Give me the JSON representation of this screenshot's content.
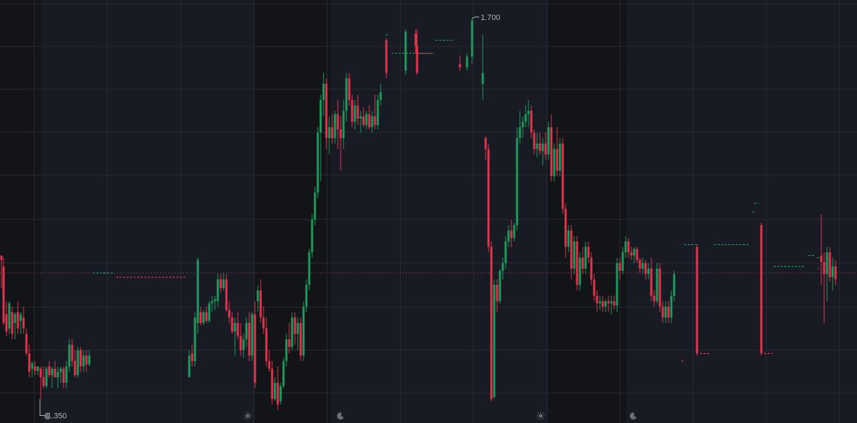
{
  "colors": {
    "background": "#181b23",
    "session_band": "#121418",
    "grid": "#262a33",
    "up": "#1f9a5c",
    "down": "#e0354c",
    "current_price_line": "#b54a55",
    "label_text": "#b2b5be",
    "icon": "#6a6f7a"
  },
  "chart_data": {
    "type": "candlestick",
    "ylim": [
      1.328,
      1.717
    ],
    "grid": true,
    "current_price": 1.466,
    "annotations": {
      "high": {
        "label": "1.700",
        "value": 1.7,
        "x": 661
      },
      "low": {
        "label": "1.350",
        "value": 1.35,
        "x": 56
      }
    },
    "session_markers": [
      {
        "x": 67,
        "icon": "moon-icon"
      },
      {
        "x": 347,
        "icon": "sun-icon"
      },
      {
        "x": 477,
        "icon": "moon-icon"
      },
      {
        "x": 757,
        "icon": "sun-icon"
      },
      {
        "x": 887,
        "icon": "moon-icon"
      }
    ],
    "candles": [
      [
        2,
        1.482,
        1.48,
        1.452,
        1.478
      ],
      [
        5,
        1.472,
        1.48,
        1.418,
        1.42
      ],
      [
        9,
        1.428,
        1.44,
        1.408,
        1.412
      ],
      [
        13,
        1.415,
        1.44,
        1.41,
        1.438
      ],
      [
        17,
        1.43,
        1.435,
        1.405,
        1.41
      ],
      [
        21,
        1.42,
        1.43,
        1.405,
        1.428
      ],
      [
        25,
        1.43,
        1.44,
        1.41,
        1.415
      ],
      [
        29,
        1.422,
        1.43,
        1.41,
        1.428
      ],
      [
        33,
        1.425,
        1.435,
        1.41,
        1.415
      ],
      [
        37,
        1.41,
        1.415,
        1.39,
        1.392
      ],
      [
        41,
        1.392,
        1.4,
        1.37,
        1.375
      ],
      [
        45,
        1.378,
        1.385,
        1.37,
        1.383
      ],
      [
        49,
        1.38,
        1.385,
        1.372,
        1.376
      ],
      [
        53,
        1.376,
        1.38,
        1.372,
        1.38
      ],
      [
        57,
        1.378,
        1.38,
        1.35,
        1.37
      ],
      [
        61,
        1.37,
        1.38,
        1.36,
        1.362
      ],
      [
        65,
        1.362,
        1.38,
        1.36,
        1.378
      ],
      [
        69,
        1.38,
        1.385,
        1.37,
        1.372
      ],
      [
        73,
        1.372,
        1.38,
        1.36,
        1.378
      ],
      [
        77,
        1.378,
        1.385,
        1.37,
        1.37
      ],
      [
        81,
        1.37,
        1.38,
        1.36,
        1.375
      ],
      [
        85,
        1.375,
        1.38,
        1.365,
        1.378
      ],
      [
        89,
        1.378,
        1.38,
        1.36,
        1.365
      ],
      [
        93,
        1.365,
        1.385,
        1.36,
        1.38
      ],
      [
        97,
        1.38,
        1.405,
        1.375,
        1.4
      ],
      [
        101,
        1.4,
        1.405,
        1.38,
        1.385
      ],
      [
        105,
        1.385,
        1.395,
        1.37,
        1.372
      ],
      [
        109,
        1.372,
        1.398,
        1.37,
        1.395
      ],
      [
        113,
        1.395,
        1.398,
        1.375,
        1.38
      ],
      [
        117,
        1.38,
        1.395,
        1.375,
        1.39
      ],
      [
        121,
        1.39,
        1.395,
        1.375,
        1.382
      ],
      [
        125,
        1.382,
        1.395,
        1.38,
        1.39
      ],
      [
        265,
        1.37,
        1.395,
        1.37,
        1.39
      ],
      [
        269,
        1.392,
        1.4,
        1.38,
        1.385
      ],
      [
        273,
        1.385,
        1.43,
        1.38,
        1.425
      ],
      [
        277,
        1.42,
        1.48,
        1.41,
        1.478
      ],
      [
        281,
        1.43,
        1.435,
        1.418,
        1.42
      ],
      [
        285,
        1.42,
        1.432,
        1.418,
        1.43
      ],
      [
        289,
        1.43,
        1.435,
        1.42,
        1.422
      ],
      [
        293,
        1.422,
        1.44,
        1.42,
        1.438
      ],
      [
        297,
        1.438,
        1.445,
        1.43,
        1.44
      ],
      [
        301,
        1.44,
        1.445,
        1.432,
        1.442
      ],
      [
        305,
        1.44,
        1.465,
        1.435,
        1.46
      ],
      [
        309,
        1.46,
        1.465,
        1.448,
        1.452
      ],
      [
        313,
        1.452,
        1.466,
        1.45,
        1.46
      ],
      [
        317,
        1.46,
        1.465,
        1.43,
        1.432
      ],
      [
        321,
        1.432,
        1.44,
        1.42,
        1.425
      ],
      [
        325,
        1.425,
        1.43,
        1.41,
        1.412
      ],
      [
        329,
        1.412,
        1.425,
        1.39,
        1.42
      ],
      [
        333,
        1.42,
        1.43,
        1.405,
        1.408
      ],
      [
        337,
        1.408,
        1.42,
        1.39,
        1.395
      ],
      [
        341,
        1.395,
        1.41,
        1.388,
        1.405
      ],
      [
        345,
        1.405,
        1.425,
        1.398,
        1.42
      ],
      [
        349,
        1.42,
        1.43,
        1.385,
        1.39
      ],
      [
        353,
        1.39,
        1.43,
        1.385,
        1.428
      ],
      [
        357,
        1.428,
        1.44,
        1.36,
        1.365
      ],
      [
        361,
        1.44,
        1.455,
        1.43,
        1.45
      ],
      [
        365,
        1.45,
        1.46,
        1.42,
        1.425
      ],
      [
        369,
        1.425,
        1.435,
        1.41,
        1.415
      ],
      [
        373,
        1.415,
        1.425,
        1.38,
        1.385
      ],
      [
        377,
        1.385,
        1.395,
        1.375,
        1.378
      ],
      [
        381,
        1.378,
        1.385,
        1.345,
        1.35
      ],
      [
        385,
        1.35,
        1.37,
        1.348,
        1.365
      ],
      [
        389,
        1.365,
        1.38,
        1.34,
        1.345
      ],
      [
        393,
        1.348,
        1.365,
        1.345,
        1.362
      ],
      [
        397,
        1.362,
        1.388,
        1.36,
        1.385
      ],
      [
        401,
        1.385,
        1.41,
        1.38,
        1.405
      ],
      [
        405,
        1.405,
        1.42,
        1.392,
        1.398
      ],
      [
        409,
        1.398,
        1.43,
        1.395,
        1.425
      ],
      [
        413,
        1.425,
        1.43,
        1.4,
        1.41
      ],
      [
        417,
        1.41,
        1.425,
        1.395,
        1.42
      ],
      [
        421,
        1.42,
        1.425,
        1.385,
        1.39
      ],
      [
        425,
        1.39,
        1.44,
        1.385,
        1.435
      ],
      [
        429,
        1.435,
        1.46,
        1.43,
        1.455
      ],
      [
        433,
        1.455,
        1.488,
        1.45,
        1.485
      ],
      [
        437,
        1.485,
        1.52,
        1.48,
        1.515
      ],
      [
        441,
        1.515,
        1.545,
        1.51,
        1.54
      ],
      [
        445,
        1.54,
        1.6,
        1.535,
        1.595
      ],
      [
        449,
        1.595,
        1.63,
        1.55,
        1.625
      ],
      [
        453,
        1.625,
        1.65,
        1.61,
        1.64
      ],
      [
        457,
        1.64,
        1.645,
        1.58,
        1.59
      ],
      [
        461,
        1.59,
        1.61,
        1.575,
        1.6
      ],
      [
        465,
        1.6,
        1.612,
        1.585,
        1.59
      ],
      [
        469,
        1.59,
        1.615,
        1.585,
        1.612
      ],
      [
        473,
        1.612,
        1.625,
        1.58,
        1.598
      ],
      [
        477,
        1.598,
        1.61,
        1.56,
        1.59
      ],
      [
        481,
        1.59,
        1.625,
        1.58,
        1.615
      ],
      [
        485,
        1.615,
        1.65,
        1.605,
        1.645
      ],
      [
        489,
        1.645,
        1.65,
        1.62,
        1.625
      ],
      [
        493,
        1.625,
        1.63,
        1.6,
        1.605
      ],
      [
        497,
        1.605,
        1.625,
        1.598,
        1.62
      ],
      [
        501,
        1.62,
        1.63,
        1.602,
        1.608
      ],
      [
        505,
        1.608,
        1.615,
        1.595,
        1.61
      ],
      [
        509,
        1.61,
        1.618,
        1.6,
        1.602
      ],
      [
        513,
        1.602,
        1.615,
        1.598,
        1.612
      ],
      [
        517,
        1.612,
        1.62,
        1.598,
        1.6
      ],
      [
        521,
        1.6,
        1.615,
        1.595,
        1.61
      ],
      [
        525,
        1.61,
        1.63,
        1.598,
        1.602
      ],
      [
        529,
        1.602,
        1.63,
        1.598,
        1.625
      ],
      [
        533,
        1.625,
        1.64,
        1.62,
        1.632
      ],
      [
        541,
        1.68,
        1.682,
        1.645,
        1.65
      ],
      [
        568,
        1.652,
        1.69,
        1.648,
        1.688
      ],
      [
        582,
        1.686,
        1.69,
        1.668,
        1.675
      ],
      [
        584,
        1.675,
        1.69,
        1.648,
        1.65
      ],
      [
        644,
        1.658,
        1.666,
        1.652,
        1.655
      ],
      [
        654,
        1.655,
        1.668,
        1.652,
        1.665
      ],
      [
        661,
        1.665,
        1.7,
        1.658,
        1.698
      ],
      [
        676,
        1.64,
        1.685,
        1.625,
        1.65
      ],
      [
        680,
        1.59,
        1.592,
        1.57,
        1.58
      ],
      [
        684,
        1.58,
        1.585,
        1.485,
        1.49
      ],
      [
        688,
        1.49,
        1.495,
        1.348,
        1.35
      ],
      [
        692,
        1.352,
        1.46,
        1.35,
        1.455
      ],
      [
        696,
        1.455,
        1.46,
        1.43,
        1.44
      ],
      [
        700,
        1.44,
        1.47,
        1.438,
        1.468
      ],
      [
        704,
        1.468,
        1.48,
        1.46,
        1.475
      ],
      [
        708,
        1.475,
        1.5,
        1.47,
        1.495
      ],
      [
        712,
        1.495,
        1.51,
        1.49,
        1.505
      ],
      [
        716,
        1.505,
        1.515,
        1.49,
        1.498
      ],
      [
        720,
        1.498,
        1.512,
        1.495,
        1.51
      ],
      [
        724,
        1.51,
        1.6,
        1.505,
        1.59
      ],
      [
        728,
        1.59,
        1.615,
        1.585,
        1.6
      ],
      [
        732,
        1.6,
        1.61,
        1.59,
        1.605
      ],
      [
        736,
        1.605,
        1.62,
        1.6,
        1.612
      ],
      [
        740,
        1.612,
        1.625,
        1.6,
        1.615
      ],
      [
        744,
        1.615,
        1.62,
        1.59,
        1.595
      ],
      [
        748,
        1.595,
        1.598,
        1.575,
        1.58
      ],
      [
        752,
        1.58,
        1.595,
        1.572,
        1.585
      ],
      [
        756,
        1.585,
        1.595,
        1.575,
        1.578
      ],
      [
        760,
        1.578,
        1.59,
        1.565,
        1.585
      ],
      [
        764,
        1.585,
        1.595,
        1.57,
        1.575
      ],
      [
        768,
        1.575,
        1.605,
        1.57,
        1.6
      ],
      [
        772,
        1.6,
        1.612,
        1.55,
        1.555
      ],
      [
        776,
        1.555,
        1.585,
        1.55,
        1.58
      ],
      [
        780,
        1.58,
        1.6,
        1.555,
        1.56
      ],
      [
        784,
        1.56,
        1.59,
        1.555,
        1.585
      ],
      [
        788,
        1.585,
        1.59,
        1.52,
        1.525
      ],
      [
        792,
        1.525,
        1.53,
        1.48,
        1.49
      ],
      [
        796,
        1.49,
        1.51,
        1.485,
        1.505
      ],
      [
        800,
        1.505,
        1.51,
        1.46,
        1.47
      ],
      [
        804,
        1.47,
        1.5,
        1.465,
        1.495
      ],
      [
        808,
        1.495,
        1.5,
        1.45,
        1.455
      ],
      [
        812,
        1.455,
        1.485,
        1.45,
        1.48
      ],
      [
        816,
        1.48,
        1.49,
        1.465,
        1.47
      ],
      [
        820,
        1.47,
        1.495,
        1.465,
        1.49
      ],
      [
        824,
        1.49,
        1.495,
        1.475,
        1.48
      ],
      [
        828,
        1.48,
        1.485,
        1.455,
        1.46
      ],
      [
        832,
        1.46,
        1.465,
        1.44,
        1.445
      ],
      [
        836,
        1.445,
        1.45,
        1.43,
        1.438
      ],
      [
        840,
        1.438,
        1.445,
        1.432,
        1.44
      ],
      [
        844,
        1.44,
        1.445,
        1.43,
        1.435
      ],
      [
        848,
        1.435,
        1.442,
        1.43,
        1.44
      ],
      [
        852,
        1.44,
        1.445,
        1.43,
        1.438
      ],
      [
        856,
        1.438,
        1.445,
        1.428,
        1.44
      ],
      [
        860,
        1.44,
        1.445,
        1.432,
        1.436
      ],
      [
        864,
        1.436,
        1.48,
        1.43,
        1.475
      ],
      [
        868,
        1.475,
        1.48,
        1.46,
        1.468
      ],
      [
        872,
        1.468,
        1.49,
        1.465,
        1.485
      ],
      [
        876,
        1.485,
        1.5,
        1.48,
        1.495
      ],
      [
        880,
        1.495,
        1.498,
        1.48,
        1.485
      ],
      [
        884,
        1.485,
        1.49,
        1.478,
        1.482
      ],
      [
        888,
        1.482,
        1.49,
        1.475,
        1.488
      ],
      [
        892,
        1.488,
        1.49,
        1.475,
        1.478
      ],
      [
        896,
        1.478,
        1.48,
        1.466,
        1.47
      ],
      [
        900,
        1.47,
        1.48,
        1.465,
        1.475
      ],
      [
        904,
        1.475,
        1.478,
        1.46,
        1.465
      ],
      [
        908,
        1.465,
        1.475,
        1.46,
        1.47
      ],
      [
        912,
        1.47,
        1.48,
        1.44,
        1.445
      ],
      [
        916,
        1.445,
        1.45,
        1.435,
        1.44
      ],
      [
        920,
        1.44,
        1.475,
        1.438,
        1.47
      ],
      [
        924,
        1.47,
        1.475,
        1.43,
        1.435
      ],
      [
        928,
        1.435,
        1.44,
        1.42,
        1.425
      ],
      [
        932,
        1.425,
        1.44,
        1.42,
        1.435
      ],
      [
        936,
        1.435,
        1.44,
        1.42,
        1.425
      ],
      [
        940,
        1.425,
        1.45,
        1.42,
        1.445
      ],
      [
        944,
        1.445,
        1.468,
        1.44,
        1.465
      ],
      [
        976,
        1.49,
        1.492,
        1.39,
        1.392
      ],
      [
        1066,
        1.51,
        1.512,
        1.39,
        1.392
      ],
      [
        1150,
        1.482,
        1.52,
        1.455,
        1.476
      ],
      [
        1154,
        1.476,
        1.485,
        1.42,
        1.465
      ],
      [
        1158,
        1.465,
        1.49,
        1.44,
        1.485
      ],
      [
        1162,
        1.485,
        1.49,
        1.458,
        1.462
      ],
      [
        1166,
        1.462,
        1.48,
        1.45,
        1.472
      ],
      [
        1170,
        1.472,
        1.478,
        1.455,
        1.46
      ]
    ],
    "flat_segments": [
      [
        130,
        160,
        1.466,
        "up"
      ],
      [
        162,
        262,
        1.462,
        "down"
      ],
      [
        540,
        545,
        1.685,
        "up"
      ],
      [
        548,
        608,
        1.668,
        "up"
      ],
      [
        586,
        606,
        1.668,
        "down"
      ],
      [
        610,
        636,
        1.68,
        "up"
      ],
      [
        958,
        976,
        1.492,
        "up"
      ],
      [
        980,
        994,
        1.392,
        "down"
      ],
      [
        1000,
        1050,
        1.492,
        "up"
      ],
      [
        1053,
        1056,
        1.522,
        "up"
      ],
      [
        1056,
        1062,
        1.53,
        "up"
      ],
      [
        1070,
        1082,
        1.392,
        "down"
      ],
      [
        1083,
        1128,
        1.472,
        "up"
      ],
      [
        1132,
        1140,
        1.482,
        "up"
      ],
      [
        1144,
        1148,
        1.48,
        "up"
      ],
      [
        1145,
        1147,
        1.47,
        "down"
      ],
      [
        954,
        957,
        1.385,
        "down"
      ]
    ]
  }
}
